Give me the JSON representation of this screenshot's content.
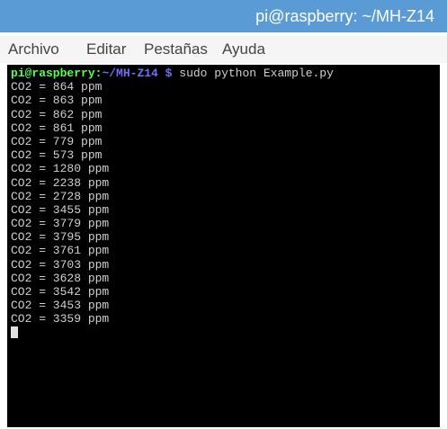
{
  "window": {
    "title": "pi@raspberry: ~/MH-Z14"
  },
  "menubar": {
    "items": [
      "Archivo",
      "Editar",
      "Pestañas",
      "Ayuda"
    ]
  },
  "terminal": {
    "prompt_user_host": "pi@raspberry",
    "prompt_colon": ":",
    "prompt_path": "~/MH-Z14",
    "prompt_symbol": " $",
    "command": " sudo python Example.py",
    "output_lines": [
      "CO2 = 864 ppm",
      "CO2 = 863 ppm",
      "CO2 = 862 ppm",
      "CO2 = 861 ppm",
      "CO2 = 779 ppm",
      "CO2 = 573 ppm",
      "CO2 = 1280 ppm",
      "CO2 = 2238 ppm",
      "CO2 = 2728 ppm",
      "CO2 = 3455 ppm",
      "CO2 = 3779 ppm",
      "CO2 = 3795 ppm",
      "CO2 = 3761 ppm",
      "CO2 = 3703 ppm",
      "CO2 = 3628 ppm",
      "CO2 = 3542 ppm",
      "CO2 = 3453 ppm",
      "CO2 = 3359 ppm"
    ]
  },
  "colors": {
    "titlebar": "#5a9bd5",
    "terminal_bg": "#000000",
    "terminal_text": "#d0d0d0",
    "prompt_user": "#55ff55",
    "prompt_path": "#6f6fff"
  }
}
